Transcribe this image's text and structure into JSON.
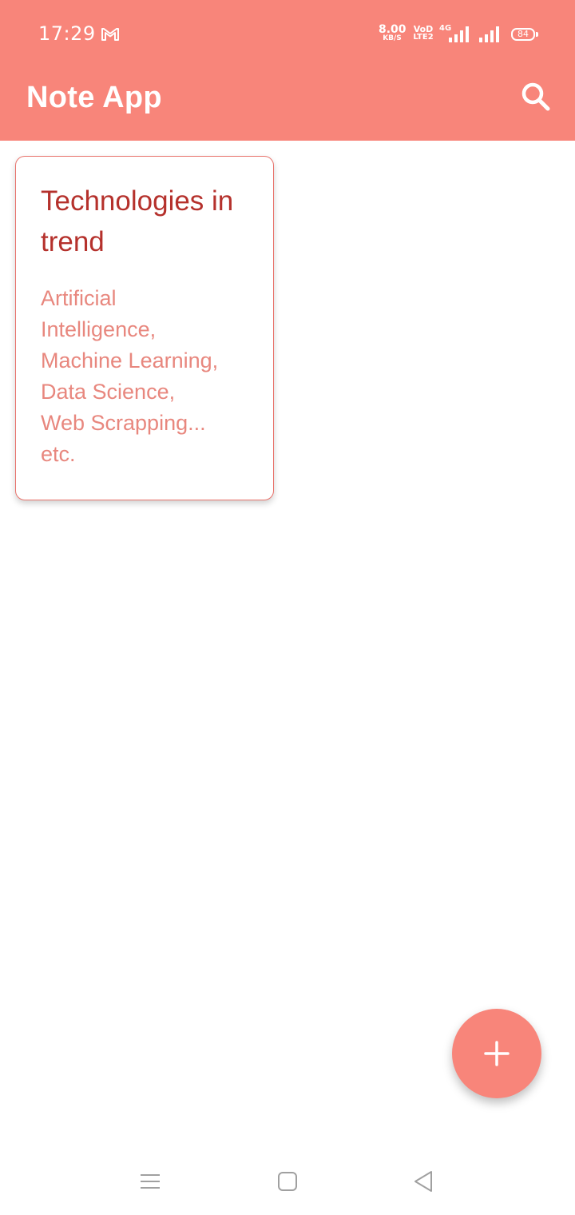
{
  "status_bar": {
    "time": "17:29",
    "mail_icon": "gmail-icon",
    "speed_value": "8.00",
    "speed_unit": "KB/S",
    "volte_top": "VoD",
    "volte_bottom": "LTE2",
    "network_type": "4G",
    "battery_level": "84"
  },
  "app_bar": {
    "title": "Note App",
    "search_icon": "search-icon"
  },
  "notes": [
    {
      "title": "Technologies in trend",
      "body": "Artificial\nIntelligence,\nMachine Learning,\nData Science,\nWeb Scrapping...\netc."
    }
  ],
  "fab": {
    "icon": "plus-icon"
  },
  "nav_bar": {
    "recents_icon": "menu-icon",
    "home_icon": "square-icon",
    "back_icon": "triangle-back-icon"
  },
  "colors": {
    "accent": "#f8857a",
    "note_title": "#b5312c",
    "note_body": "#e8877e",
    "card_border": "#e8736c"
  }
}
